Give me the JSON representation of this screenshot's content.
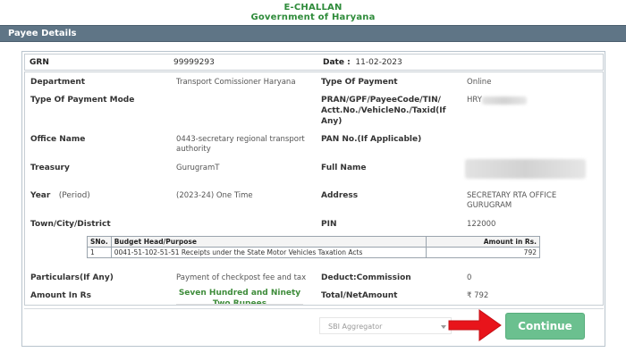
{
  "header": {
    "title": "E-CHALLAN",
    "subtitle": "Government of Haryana"
  },
  "panel": {
    "title": "Payee Details"
  },
  "grn": {
    "label": "GRN",
    "value": "99999293",
    "date_label": "Date :",
    "date_value": "11-02-2023"
  },
  "fields": {
    "department": {
      "label": "Department",
      "value": "Transport Comissioner Haryana"
    },
    "type_of_payment": {
      "label": "Type Of Payment",
      "value": "Online"
    },
    "type_of_payment_mode": {
      "label": "Type Of Payment Mode",
      "value": ""
    },
    "pran": {
      "label": "PRAN/GPF/PayeeCode/TIN/ Actt.No./VehicleNo./Taxid(If Any)",
      "value": "HRY"
    },
    "office_name": {
      "label": "Office Name",
      "value": "0443-secretary regional transport authority"
    },
    "pan": {
      "label": "PAN No.(If Applicable)",
      "value": ""
    },
    "treasury": {
      "label": "Treasury",
      "value": "GurugramT"
    },
    "full_name": {
      "label": "Full Name",
      "value": ""
    },
    "year": {
      "label": "Year",
      "sub_label": "(Period)",
      "value": "(2023-24) One Time"
    },
    "address": {
      "label": "Address",
      "value": "SECRETARY RTA OFFICE GURUGRAM"
    },
    "town": {
      "label": "Town/City/District",
      "value": ""
    },
    "pin": {
      "label": "PIN",
      "value": "122000"
    },
    "particulars": {
      "label": "Particulars(If Any)",
      "value": "Payment of checkpost fee and tax"
    },
    "deduct": {
      "label": "Deduct:Commission",
      "value": "0"
    },
    "amount_in_rs": {
      "label": "Amount In Rs",
      "value": "Seven Hundred and Ninety Two Rupees"
    },
    "total": {
      "label": "Total/NetAmount",
      "value": "₹ 792"
    }
  },
  "budget_table": {
    "headers": {
      "sno": "SNo.",
      "head": "Budget Head/Purpose",
      "amount": "Amount in Rs."
    },
    "rows": [
      {
        "sno": "1",
        "head": "0041-51-102-51-51 Receipts under the State Motor Vehicles Taxation Acts",
        "amount": "792"
      }
    ]
  },
  "aggregator": {
    "selected": "SBI Aggregator"
  },
  "actions": {
    "continue_label": "Continue"
  },
  "colors": {
    "header_green": "#2e8b3a",
    "panel_bar": "#5f7586",
    "continue_button": "#6bc08f",
    "arrow": "#e8141b"
  },
  "icons": {
    "arrow": "red-arrow-icon",
    "caret": "chevron-down-icon"
  }
}
